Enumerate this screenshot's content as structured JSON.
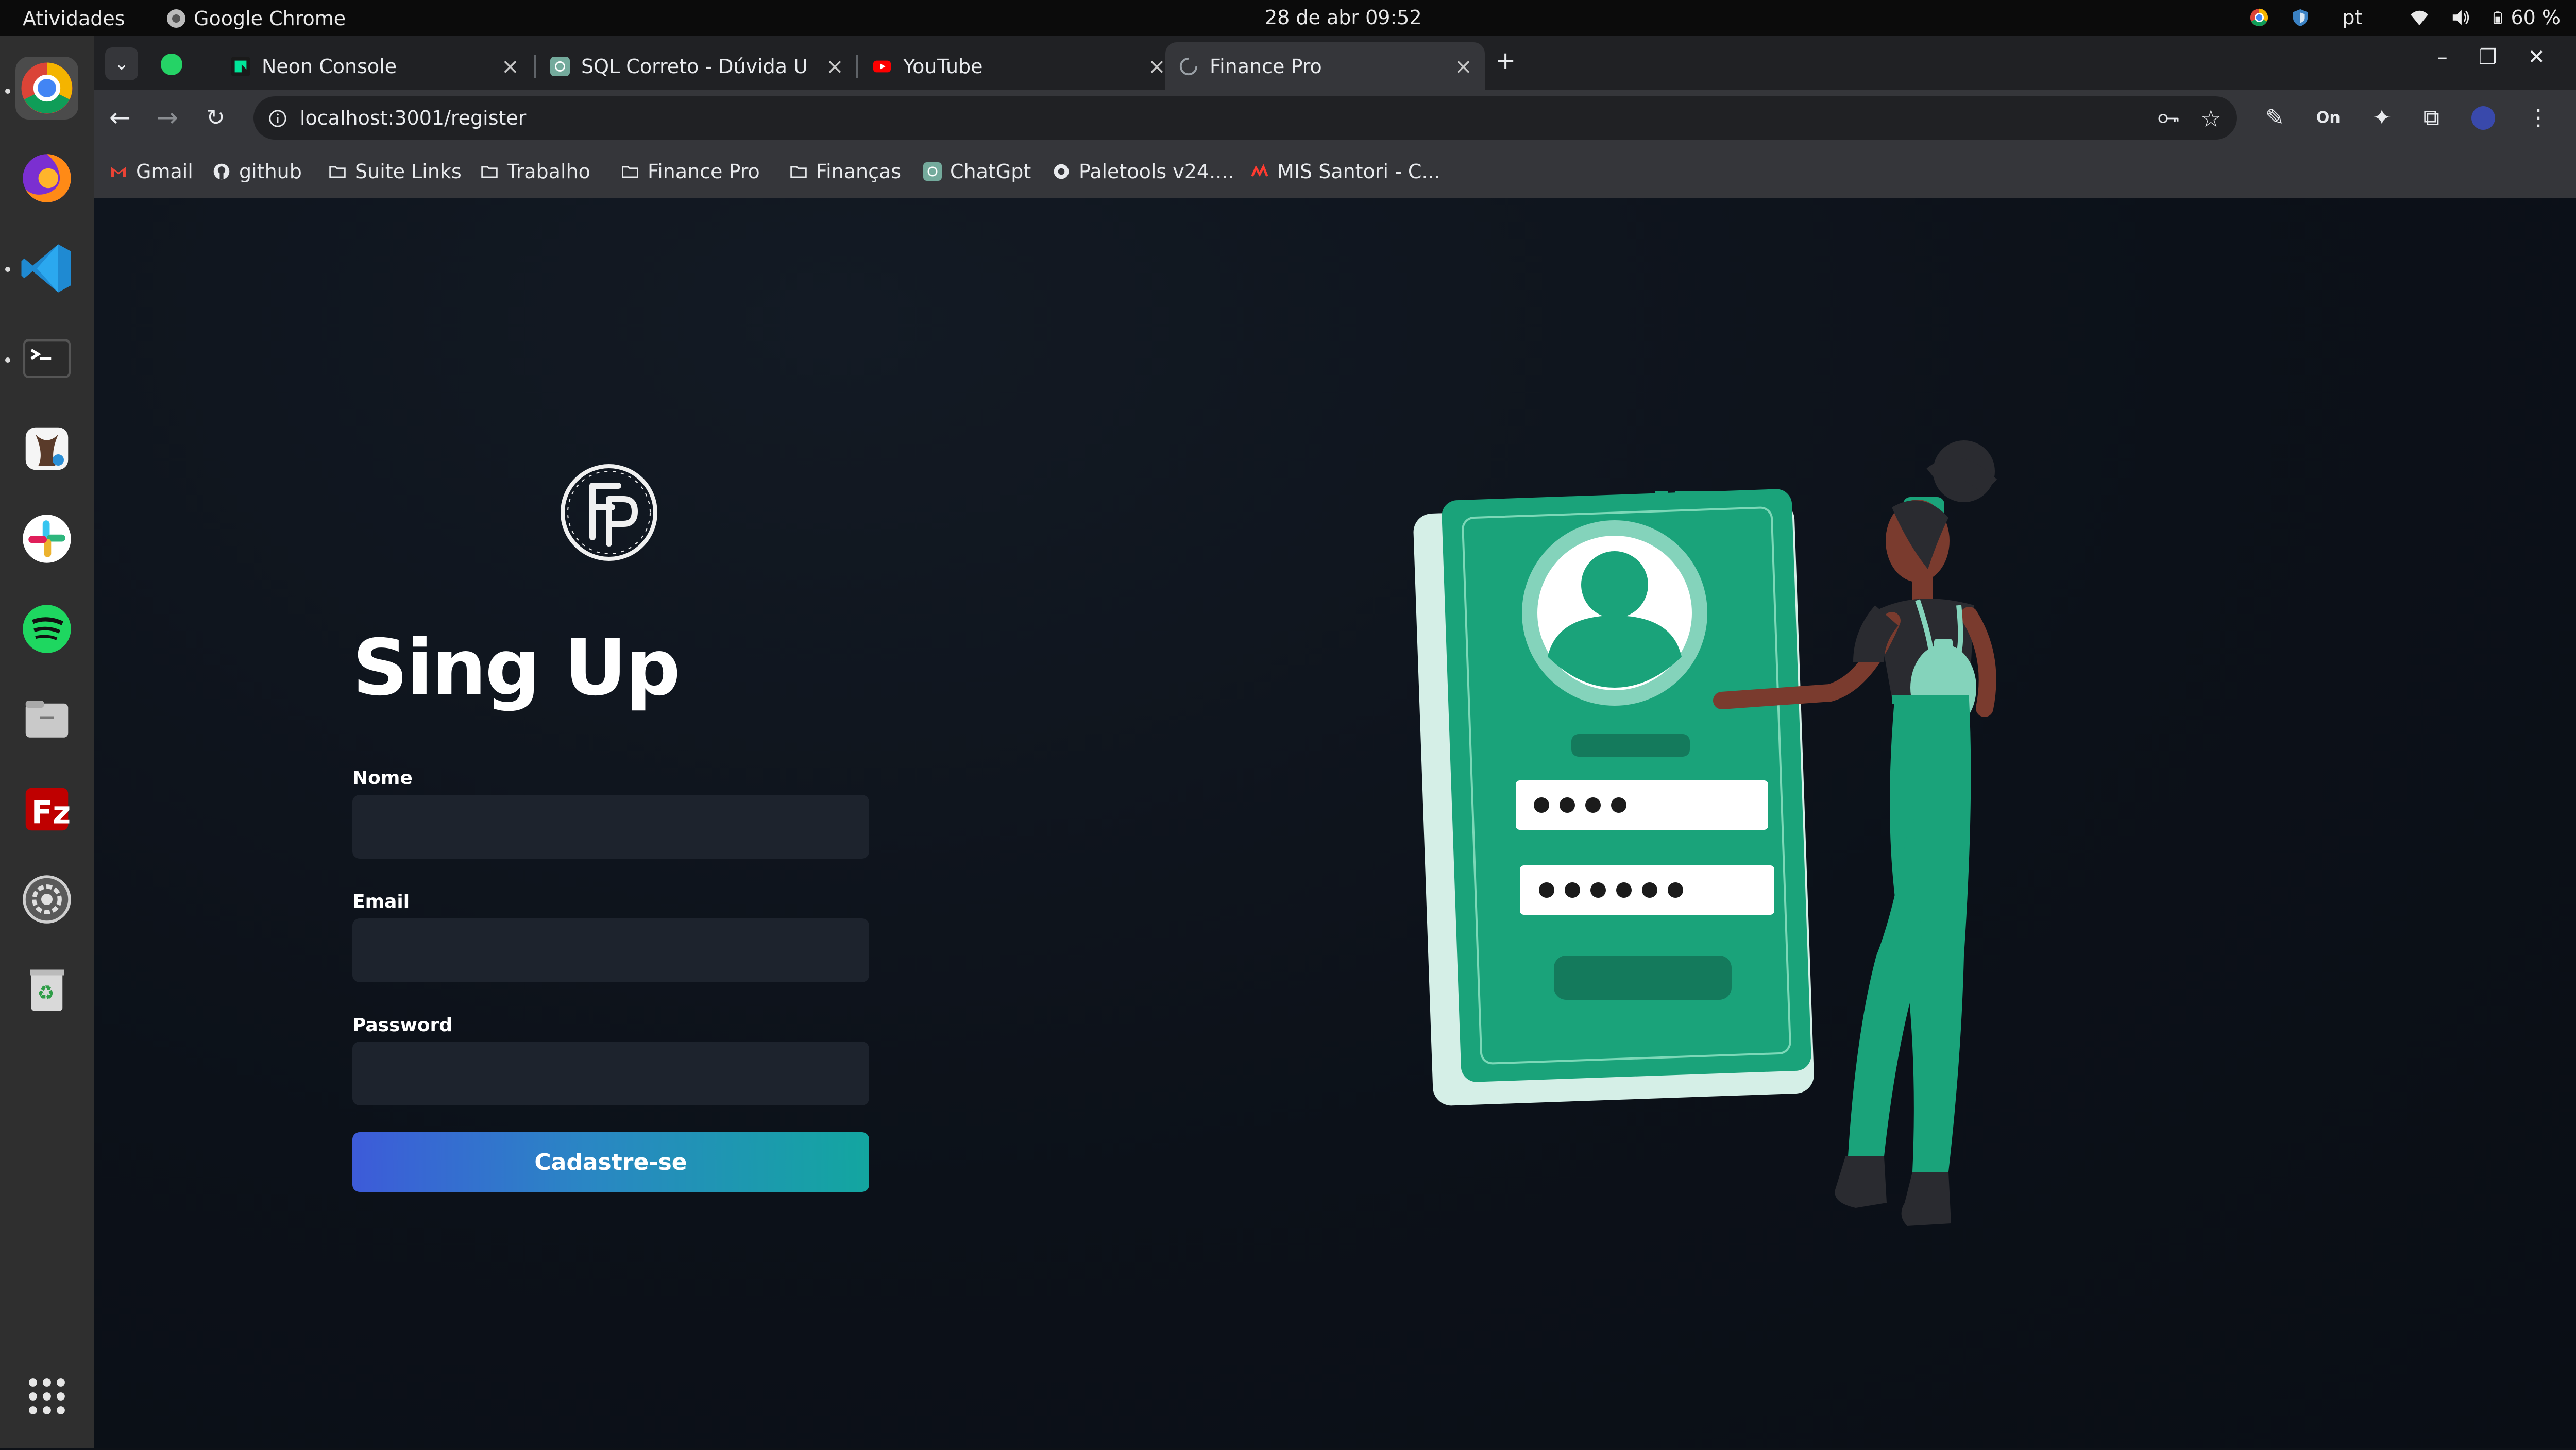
{
  "system": {
    "activities": "Atividades",
    "app_name": "Google Chrome",
    "datetime": "28 de abr  09:52",
    "language": "pt",
    "battery": "60 %"
  },
  "browser": {
    "tabs": [
      {
        "title": "Neon Console",
        "active": false
      },
      {
        "title": "SQL Correto - Dúvida Us",
        "active": false
      },
      {
        "title": "YouTube",
        "active": false
      },
      {
        "title": "Finance Pro",
        "active": true
      }
    ],
    "new_tab": "+",
    "url": "localhost:3001/register",
    "bookmarks": [
      "Gmail",
      "github",
      "Suite Links",
      "Trabalho",
      "Finance Pro",
      "Finanças",
      "ChatGpt",
      "Paletools v24....",
      "MIS Santori - C..."
    ]
  },
  "dock": {
    "items": [
      "chrome-icon",
      "firefox-icon",
      "vscode-icon",
      "terminal-icon",
      "beekeeper-icon",
      "slack-icon",
      "spotify-icon",
      "files-icon",
      "filezilla-icon",
      "settings-icon",
      "trash-icon",
      "app-grid-icon"
    ]
  },
  "form": {
    "heading": "Sing Up",
    "name_label": "Nome",
    "email_label": "Email",
    "password_label": "Password",
    "submit_label": "Cadastre-se",
    "logo_text": "FP"
  },
  "colors": {
    "accent_green": "#1aa37a",
    "button_gradient_start": "#3d5bd9",
    "button_gradient_end": "#13a6a0",
    "page_bg": "#0c1119",
    "input_bg": "#1d232d"
  }
}
